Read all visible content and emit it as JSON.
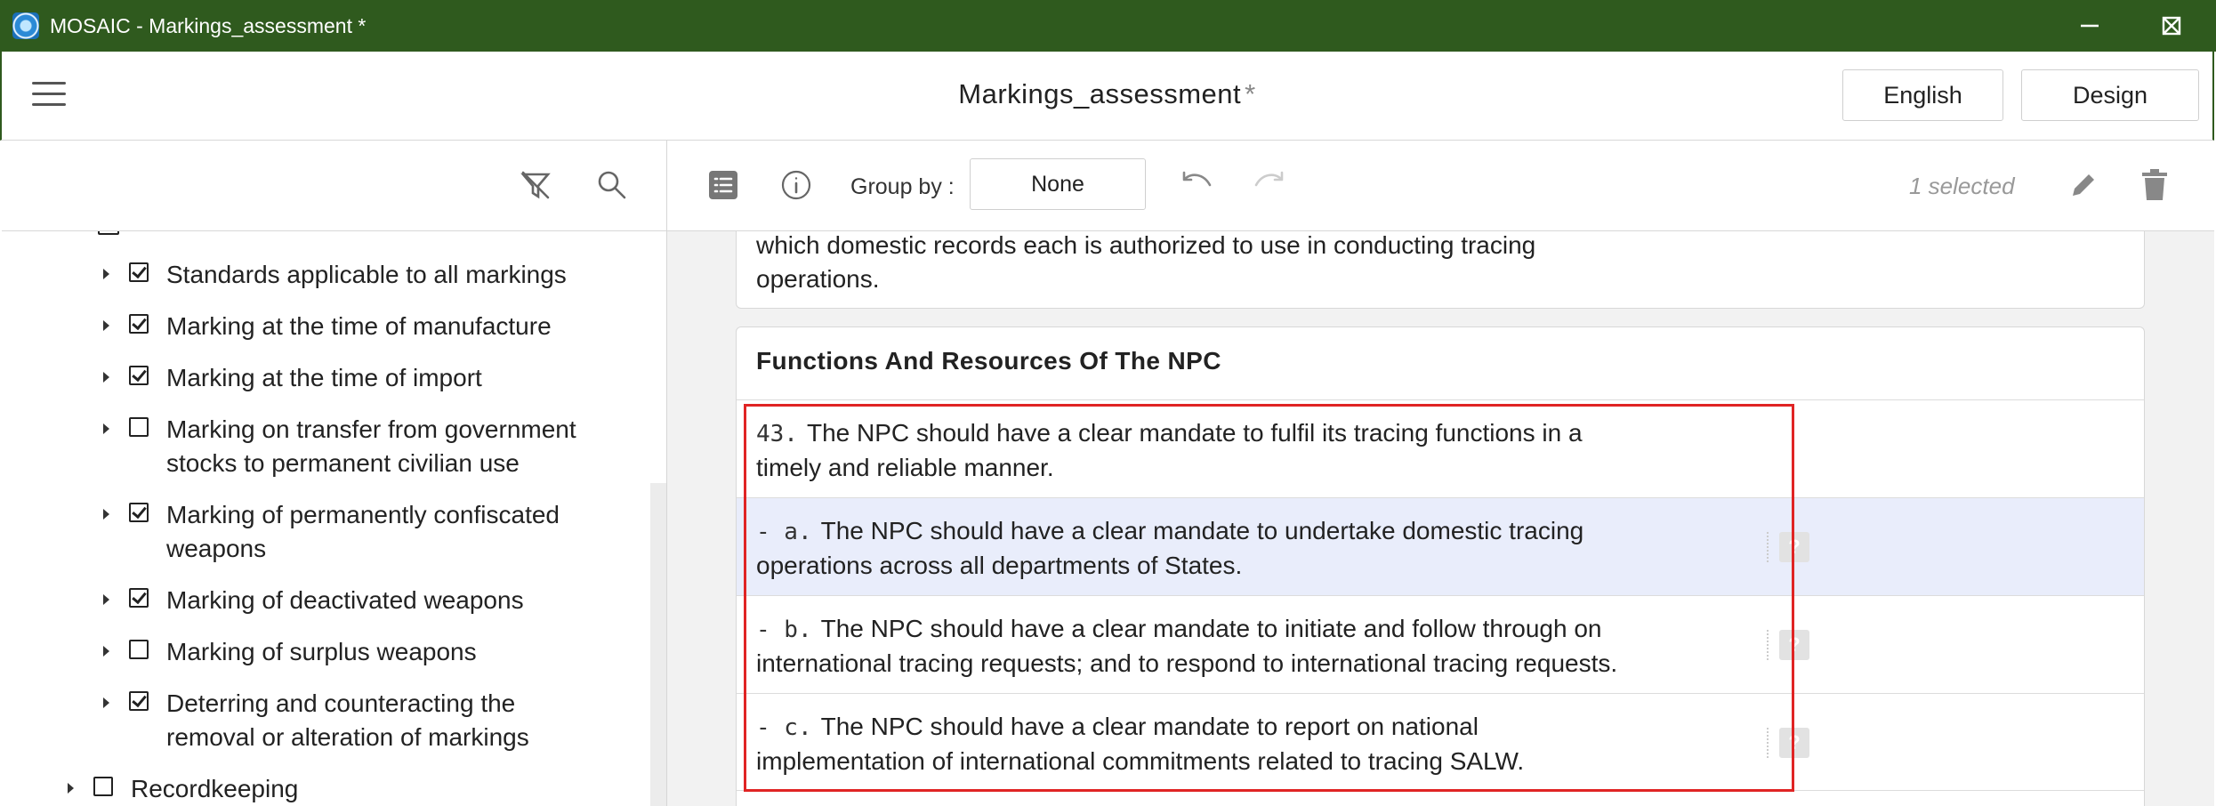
{
  "window": {
    "title": "MOSAIC - Markings_assessment *"
  },
  "header": {
    "doc_title": "Markings_assessment",
    "modified_mark": "*",
    "language_button": "English",
    "design_button": "Design"
  },
  "toolbar": {
    "group_by_label": "Group by :",
    "group_by_value": "None",
    "selected_count": "1 selected"
  },
  "tree": {
    "items": [
      {
        "label": "Standards applicable to all markings",
        "checked": true
      },
      {
        "label": "Marking at the time of manufacture",
        "checked": true
      },
      {
        "label": "Marking at the time of import",
        "checked": true
      },
      {
        "label": "Marking on transfer from government",
        "label2": "stocks to permanent civilian use",
        "checked": false
      },
      {
        "label": "Marking of permanently confiscated",
        "label2": "weapons",
        "checked": true
      },
      {
        "label": "Marking of deactivated weapons",
        "checked": true
      },
      {
        "label": "Marking of surplus weapons",
        "checked": false
      },
      {
        "label": "Deterring and counteracting the",
        "label2": "removal or alteration of markings",
        "checked": true
      },
      {
        "label": "Recordkeeping",
        "checked": false
      }
    ]
  },
  "content": {
    "prev_card": {
      "line1": "which domestic records each is authorized to use in conducting tracing",
      "line2": "operations."
    },
    "section": {
      "title": "Functions And Resources Of The NPC",
      "rows": [
        {
          "num": "43.",
          "line1": "The NPC should have a clear mandate to fulfil its tracing functions in a",
          "line2": "timely and reliable manner."
        },
        {
          "num": "- a.",
          "line1": "The NPC should have a clear mandate to undertake domestic tracing",
          "line2": "operations across all departments of States.",
          "badge": "?"
        },
        {
          "num": "- b.",
          "line1": "The NPC should have a clear mandate to initiate and follow through on",
          "line2": "international tracing requests; and to respond to international tracing requests.",
          "badge": "?"
        },
        {
          "num": "- c.",
          "line1": "The NPC should have a clear mandate to report on national",
          "line2": "implementation of international commitments related to tracing SALW.",
          "badge": "?"
        }
      ]
    }
  },
  "colors": {
    "titlebar": "#2f5a1e",
    "selected_row": "#e9edfb",
    "highlight_border": "#e02424"
  }
}
